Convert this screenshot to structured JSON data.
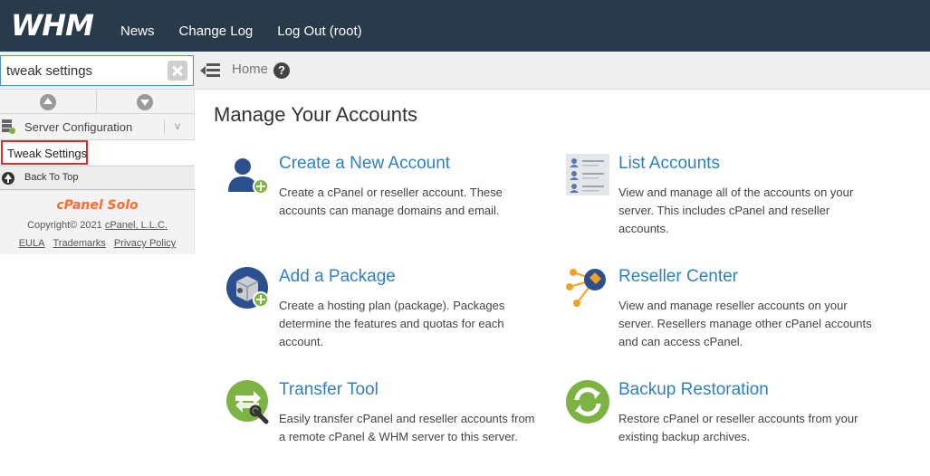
{
  "header": {
    "logo": "WHM",
    "nav": [
      "News",
      "Change Log",
      "Log Out (root)"
    ]
  },
  "search": {
    "value": "tweak settings"
  },
  "breadcrumb": {
    "home": "Home",
    "help": "?"
  },
  "sidebar": {
    "section_label": "Server Configuration",
    "section_chevron": "v",
    "item_label": "Tweak Settings",
    "back_to_top": "Back To Top",
    "brand": "cPanel Solo",
    "copyright_prefix": "Copyright© 2021",
    "copyright_link": "cPanel, L.L.C.",
    "footer_links": [
      "EULA",
      "Trademarks",
      "Privacy Policy"
    ]
  },
  "main": {
    "title": "Manage Your Accounts",
    "features": [
      {
        "title": "Create a New Account",
        "desc": "Create a cPanel or reseller account. These accounts can manage domains and email.",
        "icon": "add-user-icon"
      },
      {
        "title": "List Accounts",
        "desc": "View and manage all of the accounts on your server. This includes cPanel and reseller accounts.",
        "icon": "list-accounts-icon"
      },
      {
        "title": "Add a Package",
        "desc": "Create a hosting plan (package). Packages determine the features and quotas for each account.",
        "icon": "add-package-icon"
      },
      {
        "title": "Reseller Center",
        "desc": "View and manage reseller accounts on your server. Resellers manage other cPanel accounts and can access cPanel.",
        "icon": "reseller-center-icon"
      },
      {
        "title": "Transfer Tool",
        "desc": "Easily transfer cPanel and reseller accounts from a remote cPanel & WHM server to this server.",
        "icon": "transfer-tool-icon"
      },
      {
        "title": "Backup Restoration",
        "desc": "Restore cPanel or reseller accounts from your existing backup archives.",
        "icon": "backup-restoration-icon"
      }
    ]
  },
  "colors": {
    "topbar": "#293a4a",
    "link": "#2f7fc1",
    "brand": "#ff6c2c",
    "highlight_border": "#d32f2f",
    "green": "#7cb342"
  }
}
